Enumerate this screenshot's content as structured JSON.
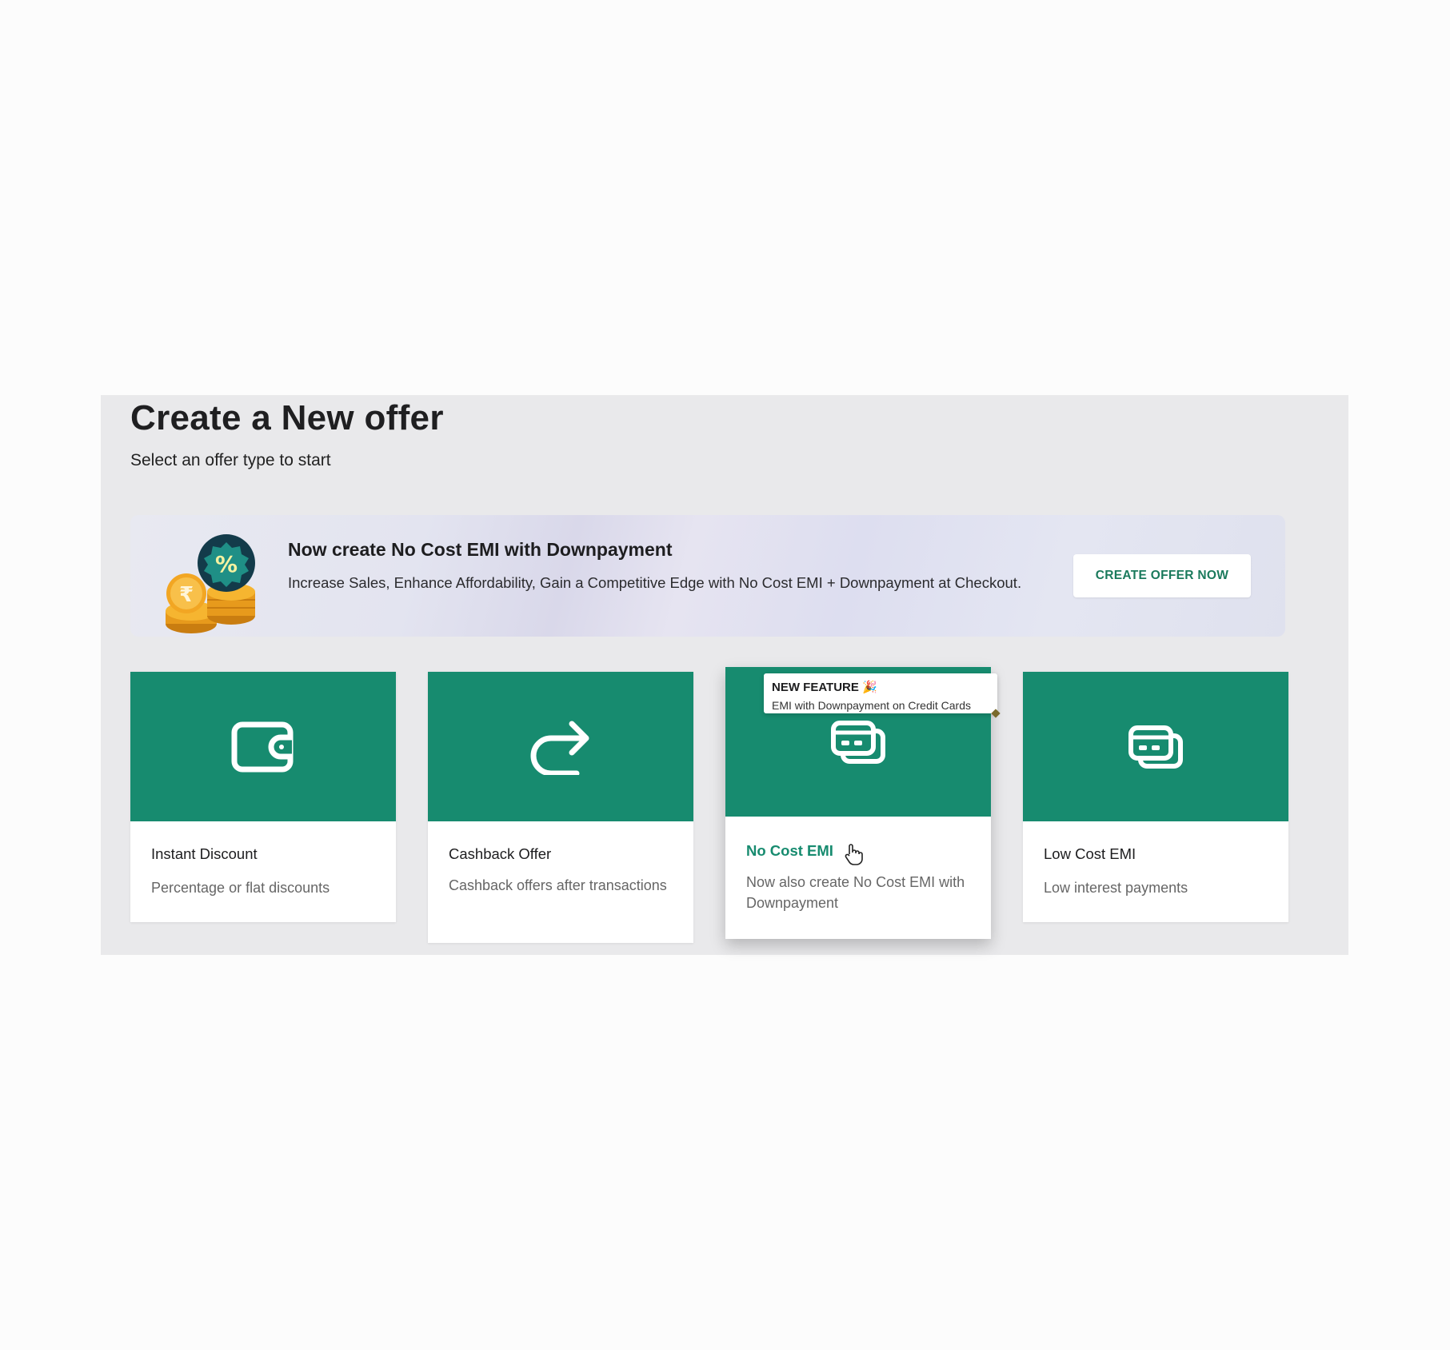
{
  "page": {
    "title": "Create a New offer",
    "subtitle": "Select an offer type to start"
  },
  "banner": {
    "title": "Now create No Cost EMI with Downpayment",
    "description": "Increase Sales, Enhance Affordability, Gain a Competitive Edge with No Cost EMI + Downpayment at Checkout.",
    "button_label": "CREATE OFFER NOW",
    "illustration_icons": [
      "rupee-coin-icon",
      "percent-badge-icon",
      "coin-stack-icon"
    ]
  },
  "offer_cards": [
    {
      "name": "Instant Discount",
      "description": "Percentage or flat discounts",
      "icon": "wallet-icon"
    },
    {
      "name": "Cashback Offer",
      "description": "Cashback offers after transactions",
      "icon": "redirect-arrow-icon"
    },
    {
      "name": "No Cost EMI",
      "description": "Now also create No Cost EMI with Downpayment",
      "icon": "credit-cards-icon",
      "state": "hover"
    },
    {
      "name": "Low Cost EMI",
      "description": "Low interest payments",
      "icon": "credit-cards-icon"
    }
  ],
  "tooltip": {
    "title": "NEW FEATURE 🎉",
    "description": "EMI with Downpayment on Credit Cards"
  },
  "colors": {
    "accent": "#178b6f",
    "button_text": "#1a7a5c",
    "panel_background": "#e9e9eb",
    "page_background": "#fcfcfc"
  }
}
